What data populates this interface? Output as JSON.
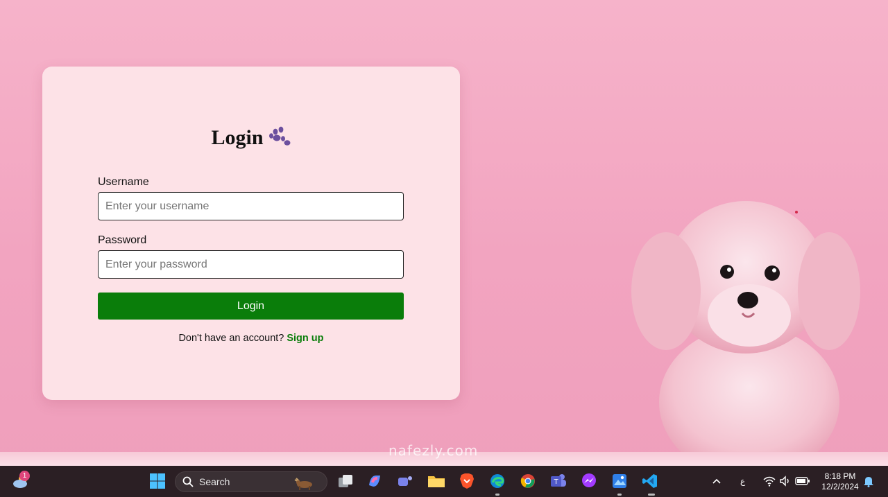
{
  "login": {
    "title": "Login",
    "username_label": "Username",
    "username_placeholder": "Enter your username",
    "password_label": "Password",
    "password_placeholder": "Enter your password",
    "button_label": "Login",
    "signup_prompt": "Don't have an account?",
    "signup_link": "Sign up"
  },
  "colors": {
    "button": "#0a7d0a",
    "card": "#fde2e7",
    "desktop": "#f3a6c2"
  },
  "watermark": "nafezly.com",
  "taskbar": {
    "weather_badge": "1",
    "search_label": "Search",
    "language_indicator": "ع",
    "clock_time": "8:18 PM",
    "clock_date": "12/2/2024",
    "icons": [
      "weather-icon",
      "windows-start-icon",
      "search-icon",
      "task-view-icon",
      "copilot-icon",
      "teams-chat-icon",
      "file-explorer-icon",
      "brave-browser-icon",
      "edge-browser-icon",
      "chrome-browser-icon",
      "teams-icon",
      "messenger-icon",
      "photos-icon",
      "vscode-icon",
      "chevron-up-icon",
      "wifi-icon",
      "volume-icon",
      "battery-icon",
      "notification-bell-icon"
    ]
  }
}
